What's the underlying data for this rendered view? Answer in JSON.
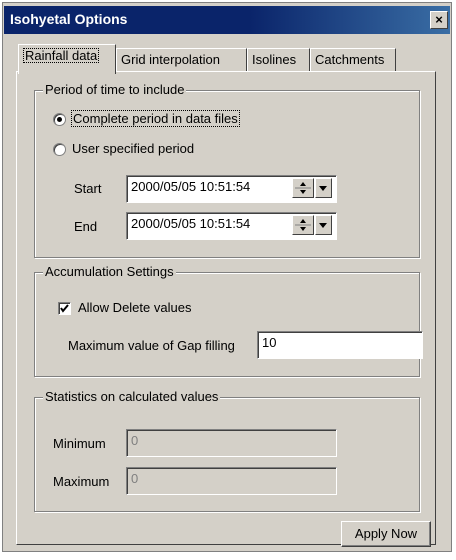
{
  "window": {
    "title": "Isohyetal Options",
    "close_glyph": "×"
  },
  "tabs": [
    {
      "label": "Rainfall data",
      "active": true
    },
    {
      "label": "Grid interpolation",
      "active": false
    },
    {
      "label": "Isolines",
      "active": false
    },
    {
      "label": "Catchments",
      "active": false
    }
  ],
  "period": {
    "legend": "Period of time to include",
    "option_complete": "Complete period in data files",
    "option_user": "User specified period",
    "selected": "complete",
    "start_label": "Start",
    "start_value": "2000/05/05 10:51:54",
    "end_label": "End",
    "end_value": "2000/05/05 10:51:54"
  },
  "accumulation": {
    "legend": "Accumulation Settings",
    "allow_delete_label": "Allow Delete values",
    "allow_delete_checked": true,
    "gap_label": "Maximum value of Gap filling",
    "gap_value": "10"
  },
  "statistics": {
    "legend": "Statistics on calculated values",
    "minimum_label": "Minimum",
    "minimum_value": "0",
    "maximum_label": "Maximum",
    "maximum_value": "0"
  },
  "apply_button": "Apply Now"
}
